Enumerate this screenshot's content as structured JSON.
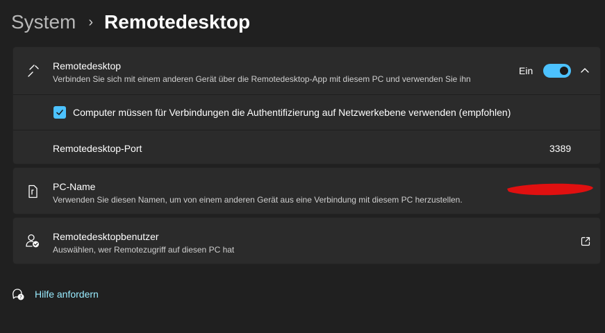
{
  "breadcrumb": {
    "parent": "System",
    "separator": "›",
    "current": "Remotedesktop"
  },
  "remote_desktop": {
    "title": "Remotedesktop",
    "subtitle": "Verbinden Sie sich mit einem anderen Gerät über die Remotedesktop-App mit diesem PC und verwenden Sie ihn",
    "toggle_label": "Ein",
    "toggle_on": true,
    "icon": "remote-desktop-icon",
    "expand_icon": "chevron-up-icon",
    "nla": {
      "checked": true,
      "label": "Computer müssen für Verbindungen die Authentifizierung auf Netzwerkebene verwenden (empfohlen)"
    },
    "port": {
      "label": "Remotedesktop-Port",
      "value": "3389"
    }
  },
  "pc_name": {
    "title": "PC-Name",
    "subtitle": "Verwenden Sie diesen Namen, um von einem anderen Gerät aus eine Verbindung mit diesem PC herzustellen.",
    "icon": "pc-name-icon"
  },
  "remote_users": {
    "title": "Remotedesktopbenutzer",
    "subtitle": "Auswählen, wer Remotezugriff auf diesen PC hat",
    "icon": "user-check-icon",
    "action_icon": "open-external-icon"
  },
  "help": {
    "label": "Hilfe anfordern",
    "icon": "help-chat-icon"
  },
  "colors": {
    "background": "#202020",
    "card": "#2b2b2b",
    "accent": "#4cc2ff",
    "link": "#99ebff",
    "redaction": "#e01010"
  }
}
